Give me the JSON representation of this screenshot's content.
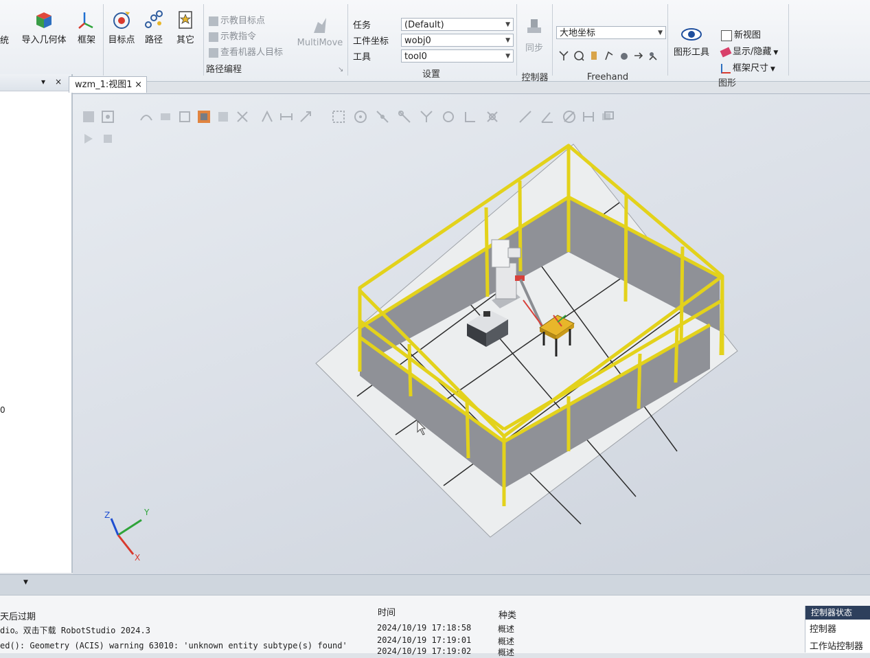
{
  "ribbon": {
    "partial_left": "统",
    "import_geometry": "导入几何体",
    "frame": "框架",
    "target": "目标点",
    "path": "路径",
    "other": "其它",
    "teach_target": "示教目标点",
    "teach_instruction": "示教指令",
    "view_robot_target": "查看机器人目标",
    "multimove": "MultiMove",
    "path_programming": "路径编程",
    "settings": {
      "task_label": "任务",
      "task_value": "(Default)",
      "wobj_label": "工件坐标",
      "wobj_value": "wobj0",
      "tool_label": "工具",
      "tool_value": "tool0",
      "group_label": "设置"
    },
    "sync": "同步",
    "controller_group": "控制器",
    "freehand": {
      "coord_value": "大地坐标",
      "group_label": "Freehand"
    },
    "graphics": {
      "graphic_tools": "图形工具",
      "new_view": "新视图",
      "show_hide": "显示/隐藏",
      "frame_size": "框架尺寸",
      "group_label": "图形"
    }
  },
  "document_tab": {
    "label": "wzm_1:视图1",
    "close": "×"
  },
  "left_panel": {
    "pin": "▾",
    "close": "×",
    "partial_text": "0"
  },
  "axes": {
    "x": "X",
    "y": "Y",
    "z": "Z"
  },
  "output": {
    "columns": {
      "time": "时间",
      "category": "种类"
    },
    "rows": [
      {
        "message": "天后过期",
        "time": "",
        "category": ""
      },
      {
        "message": "dio。双击下载 RobotStudio 2024.3",
        "time": "2024/10/19 17:18:58",
        "category": "概述"
      },
      {
        "message": "ed(): Geometry (ACIS) warning 63010: 'unknown entity subtype(s) found'",
        "time": "2024/10/19 17:19:01",
        "category": "概述"
      },
      {
        "message": "",
        "time": "2024/10/19 17:19:02",
        "category": "概述"
      }
    ]
  },
  "status_panel": {
    "title": "控制器状态",
    "controller": "控制器",
    "station_controller": "工作站控制器"
  },
  "colors": {
    "fence_yellow": "#e3d21b",
    "fence_panel": "#8f9197",
    "floor": "#eceeef",
    "status_header": "#2d3f5c"
  }
}
